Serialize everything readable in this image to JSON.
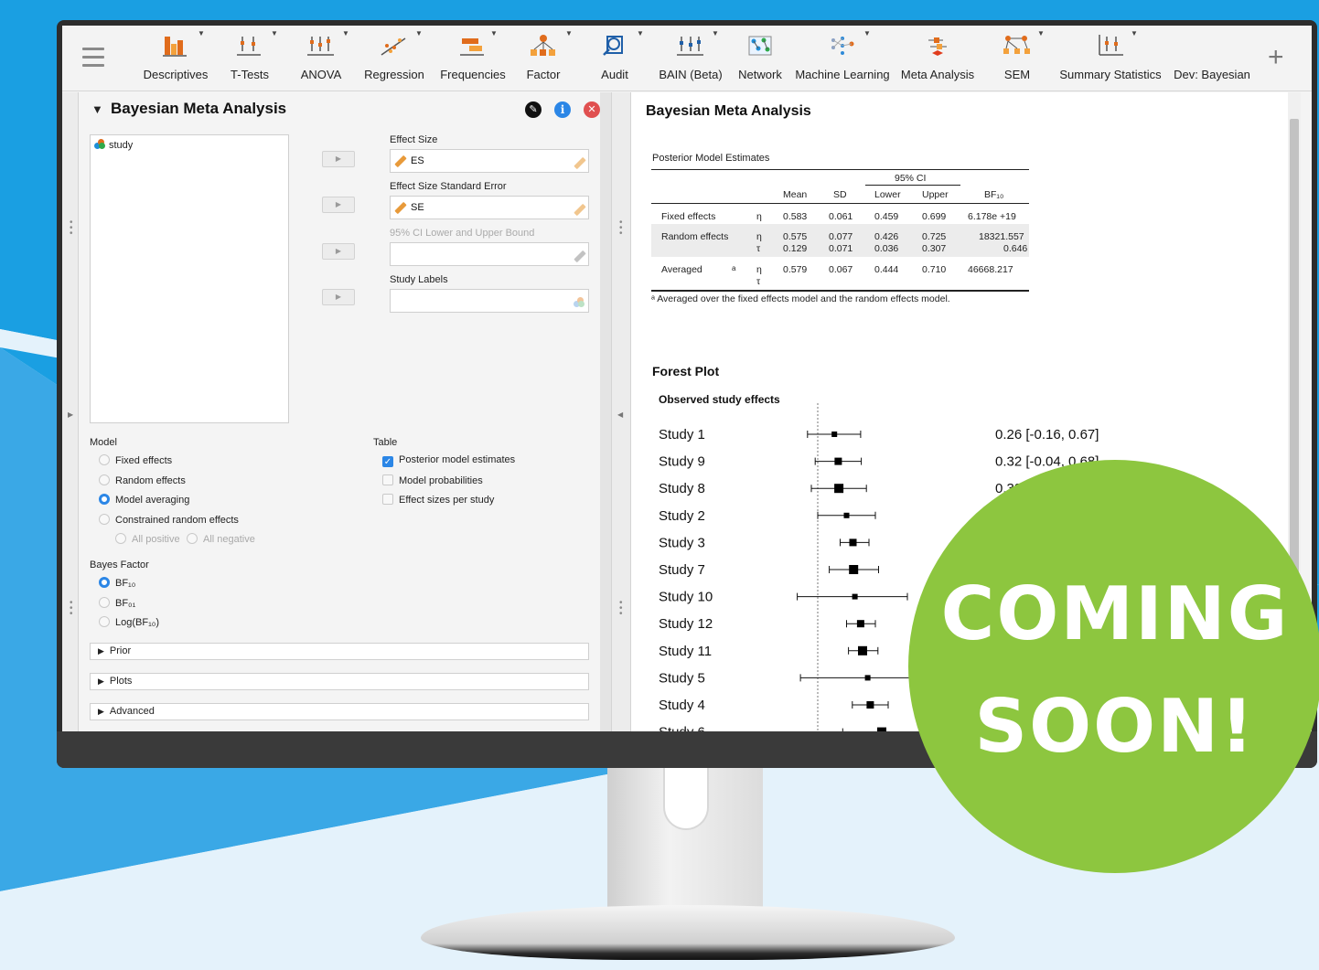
{
  "ribbon": {
    "items": [
      {
        "label": "Descriptives",
        "icon": "descriptives-icon"
      },
      {
        "label": "T-Tests",
        "icon": "ttest-icon"
      },
      {
        "label": "ANOVA",
        "icon": "anova-icon"
      },
      {
        "label": "Regression",
        "icon": "regression-icon"
      },
      {
        "label": "Frequencies",
        "icon": "frequencies-icon"
      },
      {
        "label": "Factor",
        "icon": "factor-icon"
      },
      {
        "label": "Audit",
        "icon": "audit-icon"
      },
      {
        "label": "BAIN (Beta)",
        "icon": "bain-icon"
      },
      {
        "label": "Network",
        "icon": "network-icon"
      },
      {
        "label": "Machine Learning",
        "icon": "machine-learning-icon"
      },
      {
        "label": "Meta Analysis",
        "icon": "meta-analysis-icon"
      },
      {
        "label": "SEM",
        "icon": "sem-icon"
      },
      {
        "label": "Summary Statistics",
        "icon": "summary-statistics-icon"
      },
      {
        "label": "Dev: Bayesian",
        "icon": ""
      }
    ]
  },
  "analysis": {
    "title": "Bayesian Meta Analysis",
    "variables": [
      "study"
    ],
    "effect_size_label": "Effect Size",
    "effect_size_value": "ES",
    "se_label": "Effect Size Standard Error",
    "se_value": "SE",
    "ci_label": "95% CI Lower and Upper Bound",
    "study_labels_label": "Study Labels",
    "model_label": "Model",
    "model_options": [
      "Fixed effects",
      "Random effects",
      "Model averaging",
      "Constrained random effects"
    ],
    "model_selected": "Model averaging",
    "constrained_options": [
      "All positive",
      "All negative"
    ],
    "table_label": "Table",
    "table_options": [
      {
        "label": "Posterior model estimates",
        "checked": true
      },
      {
        "label": "Model probabilities",
        "checked": false
      },
      {
        "label": "Effect sizes per study",
        "checked": false
      }
    ],
    "bayes_factor_label": "Bayes Factor",
    "bf_options": [
      "BF₁₀",
      "BF₀₁",
      "Log(BF₁₀)"
    ],
    "bf_selected": "BF₁₀",
    "sections": [
      "Prior",
      "Plots",
      "Advanced"
    ]
  },
  "output": {
    "title": "Bayesian Meta Analysis",
    "table_title": "Posterior Model Estimates",
    "ci_header": "95% CI",
    "columns": [
      "Mean",
      "SD",
      "Lower",
      "Upper",
      "BF₁₀"
    ],
    "rows": [
      {
        "label": "Fixed effects",
        "sup": "",
        "param": "η",
        "mean": "0.583",
        "sd": "0.061",
        "lower": "0.459",
        "upper": "0.699",
        "bf": "6.178e +19"
      },
      {
        "label": "Random effects",
        "sup": "",
        "param": "η",
        "mean": "0.575",
        "sd": "0.077",
        "lower": "0.426",
        "upper": "0.725",
        "bf": "18321.557"
      },
      {
        "label": "",
        "sup": "",
        "param": "τ",
        "mean": "0.129",
        "sd": "0.071",
        "lower": "0.036",
        "upper": "0.307",
        "bf": "0.646"
      },
      {
        "label": "Averaged",
        "sup": "a",
        "param": "η",
        "mean": "0.579",
        "sd": "0.067",
        "lower": "0.444",
        "upper": "0.710",
        "bf": "46668.217"
      },
      {
        "label": "",
        "sup": "",
        "param": "τ",
        "mean": "",
        "sd": "",
        "lower": "",
        "upper": "",
        "bf": ""
      }
    ],
    "footnote": "ᵃ Averaged over the fixed effects model and the random effects model.",
    "forest_title": "Forest Plot",
    "forest_subtitle": "Observed study effects"
  },
  "forest": {
    "studies": [
      {
        "name": "Study 1",
        "est": 0.26,
        "lo": -0.16,
        "hi": 0.67,
        "text": "0.26 [-0.16, 0.67]"
      },
      {
        "name": "Study 9",
        "est": 0.32,
        "lo": -0.04,
        "hi": 0.68,
        "text": "0.32 [-0.04, 0.68]"
      },
      {
        "name": "Study 8",
        "est": 0.33,
        "lo": -0.1,
        "hi": 0.76,
        "text": "0.33 [-0.10, 0.76]"
      },
      {
        "name": "Study 2",
        "est": 0.45,
        "lo": 0.0,
        "hi": 0.9,
        "text": "0.4"
      },
      {
        "name": "Study 3",
        "est": 0.55,
        "lo": 0.35,
        "hi": 0.8,
        "text": ""
      },
      {
        "name": "Study 7",
        "est": 0.56,
        "lo": 0.18,
        "hi": 0.95,
        "text": ""
      },
      {
        "name": "Study 10",
        "est": 0.58,
        "lo": -0.32,
        "hi": 1.4,
        "text": ""
      },
      {
        "name": "Study 12",
        "est": 0.67,
        "lo": 0.45,
        "hi": 0.9,
        "text": ""
      },
      {
        "name": "Study 11",
        "est": 0.7,
        "lo": 0.48,
        "hi": 0.94,
        "text": ""
      },
      {
        "name": "Study 5",
        "est": 0.78,
        "lo": -0.27,
        "hi": 1.5,
        "text": ""
      },
      {
        "name": "Study 4",
        "est": 0.82,
        "lo": 0.54,
        "hi": 1.1,
        "text": ""
      },
      {
        "name": "Study 6",
        "est": 1.0,
        "lo": 0.39,
        "hi": 1.6,
        "text": ""
      }
    ]
  },
  "badge": {
    "line1": "COMING",
    "line2": "SOON!",
    "color": "#8dc63f"
  },
  "colors": {
    "accent": "#2b86e6",
    "background_blue": "#1d9fe0"
  }
}
